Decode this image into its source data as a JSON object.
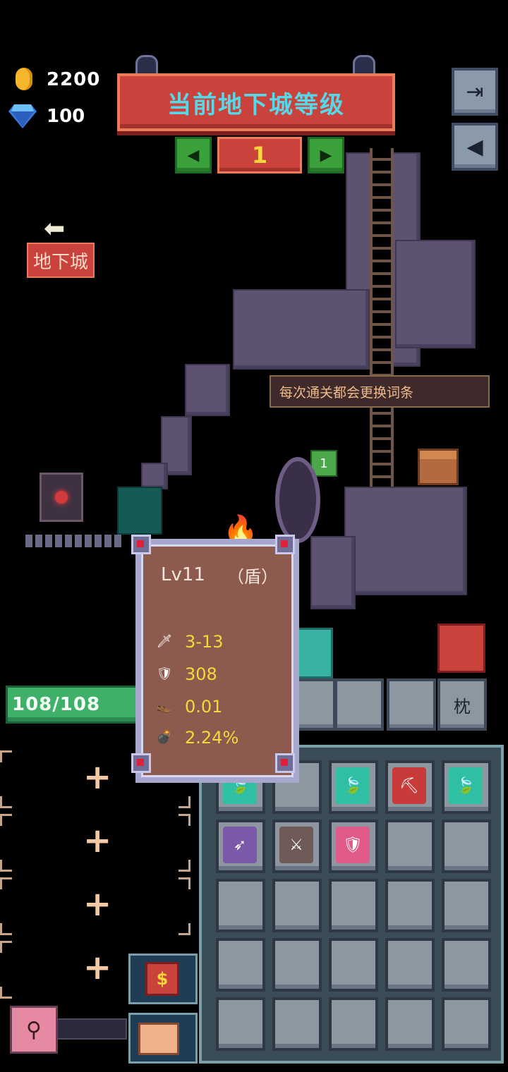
{
  "currency": {
    "coins": "2200",
    "gems": "100",
    "coin_icon": "gold-coin-icon",
    "gem_icon": "blue-diamond-icon"
  },
  "dungeon": {
    "banner_title": "当前地下城等级",
    "level": "1",
    "prev_icon": "left-arrow-icon",
    "next_icon": "right-arrow-icon"
  },
  "side_buttons": [
    {
      "name": "exit-button",
      "glyph": "⇥"
    },
    {
      "name": "sound-button",
      "glyph": "◀"
    }
  ],
  "nav": {
    "back_arrow": "⬅",
    "dungeon_label": "地下城"
  },
  "scene": {
    "tip_text": "每次通关都会更换词条",
    "npc_level": "1"
  },
  "item_card": {
    "title": "Lv11",
    "type": "（盾）",
    "stats": [
      {
        "icon": "sword-icon",
        "glyph": "🗡",
        "value": "3-13"
      },
      {
        "icon": "shield-icon",
        "glyph": "🛡",
        "value": "308"
      },
      {
        "icon": "boot-icon",
        "glyph": "👞",
        "value": "0.01"
      },
      {
        "icon": "bomb-icon",
        "glyph": "💣",
        "value": "2.24%"
      }
    ]
  },
  "player": {
    "hp": "108/108"
  },
  "inventory": {
    "sort_label": "枕",
    "items": [
      {
        "name": "leaf-book-teal",
        "color": "#2fc0a4",
        "glyph": "🍃"
      },
      {
        "name": "empty",
        "color": "",
        "glyph": ""
      },
      {
        "name": "leaf-book-teal",
        "color": "#2fc0a4",
        "glyph": "🍃"
      },
      {
        "name": "pickaxe-book-red",
        "color": "#c93b3b",
        "glyph": "⛏"
      },
      {
        "name": "leaf-book-teal",
        "color": "#2fc0a4",
        "glyph": "🍃"
      },
      {
        "name": "bow-book-purple",
        "color": "#7a5aa8",
        "glyph": "➶"
      },
      {
        "name": "sword-book-brown",
        "color": "#6e5a56",
        "glyph": "⚔"
      },
      {
        "name": "shield-book-pink",
        "color": "#e05a8a",
        "glyph": "🛡"
      }
    ]
  },
  "buttons": {
    "shop_label": "$"
  },
  "colors": {
    "banner_red": "#c9433c",
    "title_cyan": "#56d8e8",
    "stat_yellow": "#f5d93a",
    "hp_green": "#3fb06a"
  }
}
